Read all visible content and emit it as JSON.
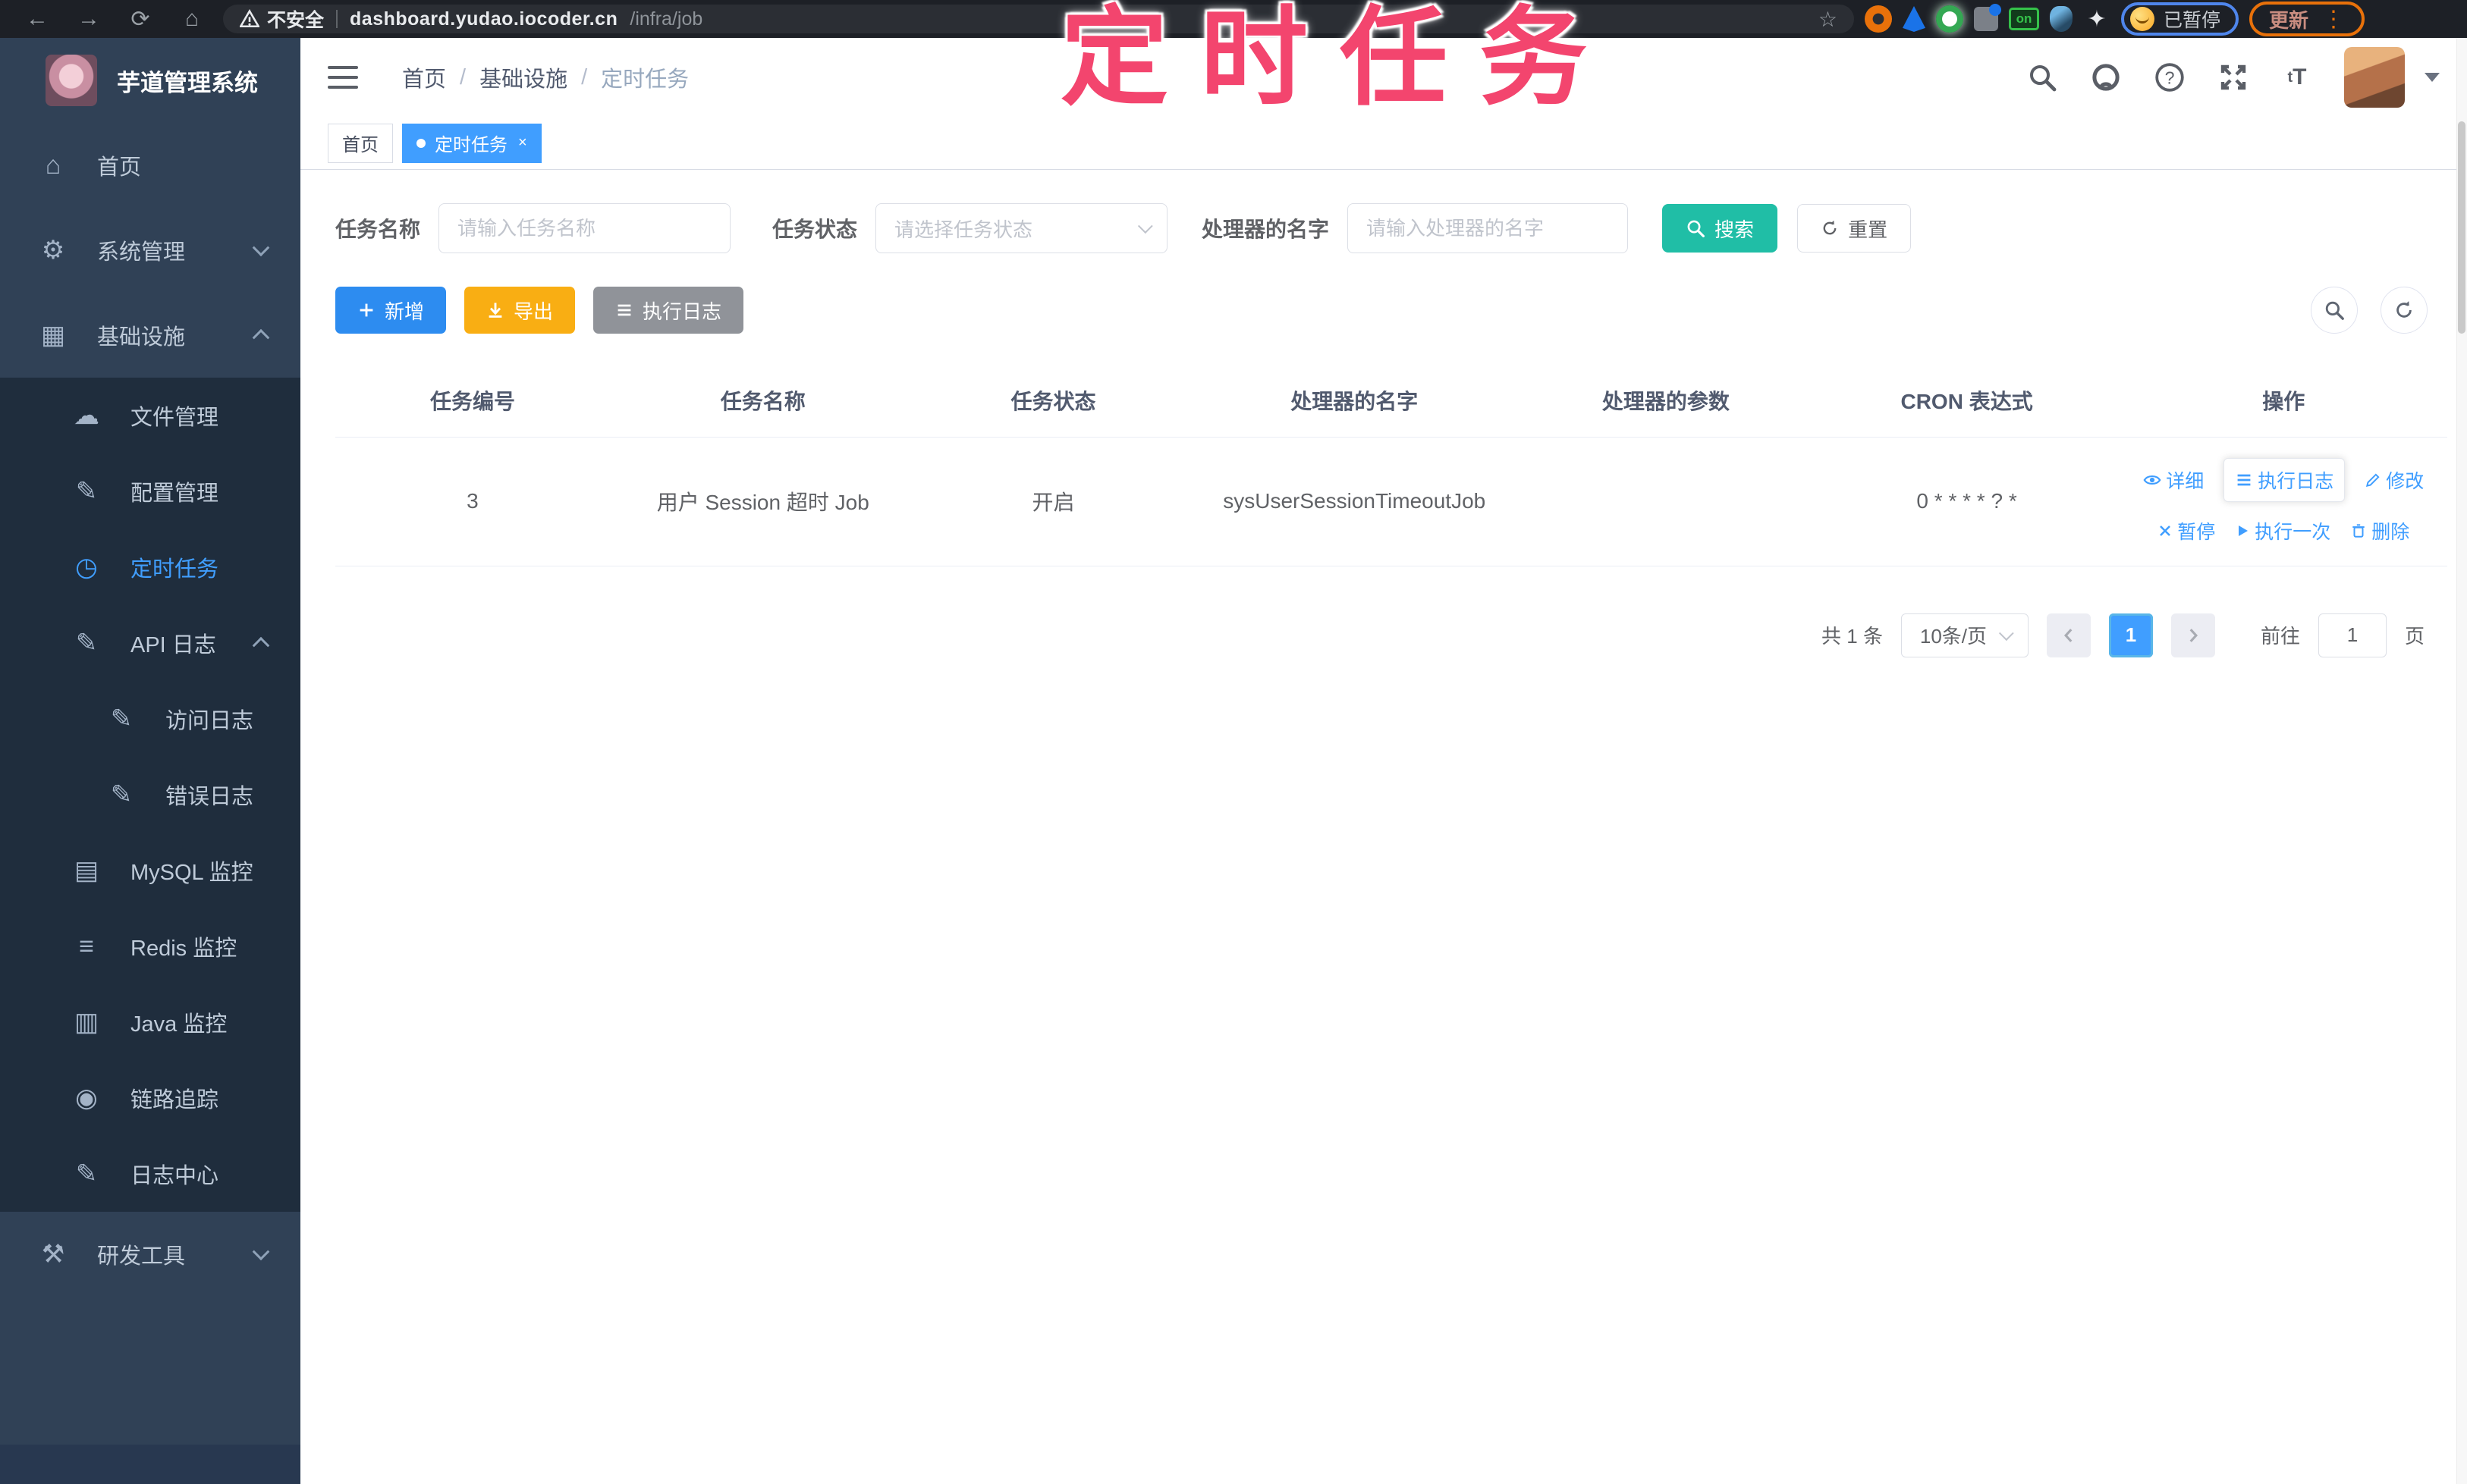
{
  "browser": {
    "security_label": "不安全",
    "url_domain": "dashboard.yudao.iocoder.cn",
    "url_path": "/infra/job",
    "extension_on_badge": "on",
    "paused_label": "已暂停",
    "update_label": "更新",
    "icons": {
      "back": "←",
      "forward": "→",
      "reload": "⟳",
      "home": "⌂",
      "bookmark_star": "☆",
      "menu_dots": "⋮",
      "puzzle": "✦"
    }
  },
  "annotation": {
    "overlay_title": "定时任务",
    "overlay_color": "#f3456e"
  },
  "sidebar": {
    "logo_title": "芋道管理系统",
    "menu": [
      {
        "label": "首页",
        "glyph": "⌂"
      },
      {
        "label": "系统管理",
        "glyph": "⚙",
        "chevron": "down"
      },
      {
        "label": "基础设施",
        "glyph": "▦",
        "chevron": "up"
      }
    ],
    "submenu": [
      {
        "label": "文件管理",
        "glyph": "☁"
      },
      {
        "label": "配置管理",
        "glyph": "✎"
      },
      {
        "label": "定时任务",
        "glyph": "◷",
        "active": true
      },
      {
        "label": "API 日志",
        "glyph": "✎",
        "chevron": "up"
      },
      {
        "label": "访问日志",
        "glyph": "✎",
        "indent": 2
      },
      {
        "label": "错误日志",
        "glyph": "✎",
        "indent": 2
      },
      {
        "label": "MySQL 监控",
        "glyph": "▤"
      },
      {
        "label": "Redis 监控",
        "glyph": "≡"
      },
      {
        "label": "Java 监控",
        "glyph": "▥"
      },
      {
        "label": "链路追踪",
        "glyph": "◉"
      },
      {
        "label": "日志中心",
        "glyph": "✎"
      }
    ],
    "bottom_menu": [
      {
        "label": "研发工具",
        "glyph": "⚒",
        "chevron": "down"
      }
    ]
  },
  "header": {
    "breadcrumb": {
      "0": "首页",
      "1": "基础设施",
      "2": "定时任务",
      "separator": "/"
    },
    "text_size_icon_label": "tT"
  },
  "tabs": [
    {
      "label": "首页"
    },
    {
      "label": "定时任务",
      "close": "×"
    }
  ],
  "filters": {
    "task_name_label": "任务名称",
    "task_name_placeholder": "请输入任务名称",
    "task_status_label": "任务状态",
    "task_status_placeholder": "请选择任务状态",
    "handler_label": "处理器的名字",
    "handler_placeholder": "请输入处理器的名字",
    "search_label": "搜索",
    "reset_label": "重置"
  },
  "toolbar": {
    "add_label": "新增",
    "export_label": "导出",
    "exec_log_label": "执行日志"
  },
  "table": {
    "headers": [
      "任务编号",
      "任务名称",
      "任务状态",
      "处理器的名字",
      "处理器的参数",
      "CRON 表达式",
      "操作"
    ],
    "row": {
      "id": "3",
      "name": "用户 Session 超时 Job",
      "status": "开启",
      "handler": "sysUserSessionTimeoutJob",
      "params": "",
      "cron": "0 * * * * ? *",
      "actions_row1": [
        "详细",
        "执行日志",
        "修改"
      ],
      "actions_row2": [
        "暂停",
        "执行一次",
        "删除"
      ]
    }
  },
  "pagination": {
    "total": "共 1 条",
    "page_size": "10条/页",
    "current_page": "1",
    "goto_label": "前往",
    "goto_value": "1",
    "page_unit": "页"
  }
}
